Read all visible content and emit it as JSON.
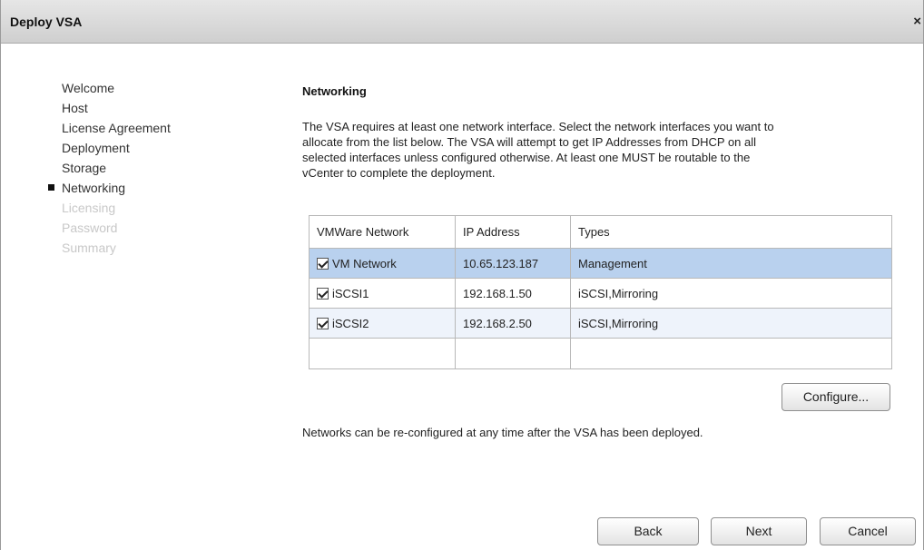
{
  "window": {
    "title": "Deploy VSA",
    "close_glyph": "×"
  },
  "steps": [
    {
      "label": "Welcome",
      "state": "done"
    },
    {
      "label": "Host",
      "state": "done"
    },
    {
      "label": "License Agreement",
      "state": "done"
    },
    {
      "label": "Deployment",
      "state": "done"
    },
    {
      "label": "Storage",
      "state": "done"
    },
    {
      "label": "Networking",
      "state": "current"
    },
    {
      "label": "Licensing",
      "state": "pending"
    },
    {
      "label": "Password",
      "state": "pending"
    },
    {
      "label": "Summary",
      "state": "pending"
    }
  ],
  "main": {
    "title": "Networking",
    "intro_lines": [
      "The VSA requires at least one network interface. Select the network interfaces you want to",
      "allocate from the list below. The VSA will attempt to get IP Addresses from DHCP on all",
      "selected interfaces unless configured otherwise. At least one MUST be routable to the",
      "vCenter to complete the deployment."
    ],
    "table": {
      "headers": [
        "VMWare Network",
        "IP Address",
        "Types"
      ],
      "rows": [
        {
          "checked": true,
          "network": "VM Network",
          "ip": "10.65.123.187",
          "types": "Management",
          "selected": true
        },
        {
          "checked": true,
          "network": "iSCSI1",
          "ip": "192.168.1.50",
          "types": "iSCSI,Mirroring",
          "selected": false
        },
        {
          "checked": true,
          "network": "iSCSI2",
          "ip": "192.168.2.50",
          "types": "iSCSI,Mirroring",
          "selected": false
        }
      ]
    },
    "configure_label": "Configure...",
    "footnote": "Networks can be re-configured at any time after the VSA has been deployed."
  },
  "buttons": {
    "back": "Back",
    "next": "Next",
    "cancel": "Cancel"
  },
  "colors": {
    "selected_row": "#b9d1ee",
    "alt_row": "#eef3fb",
    "disabled_step": "#c8c8c8",
    "titlebar": "#d9d9d9"
  },
  "icons": {
    "step_current": "square-bullet-icon",
    "close": "close-icon",
    "checkbox": "checkbox-checked-icon"
  }
}
